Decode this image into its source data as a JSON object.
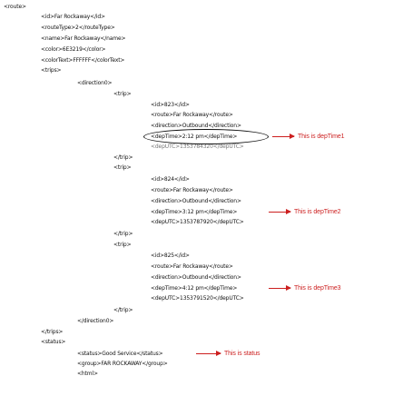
{
  "lines": [
    "<route>",
    "<id>Far Rockaway</id>",
    "<routeType>2</routeType>",
    "<name>Far Rockaway</name>",
    "<color>6E3219</color>",
    "<colorText>FFFFFF</colorText>",
    "<trips>",
    "<direction0>",
    "<trip>",
    "<id>823</id>",
    "<route>Far Rockaway</route>",
    "<direction>Outbound</direction>",
    "<depTime>2:12 pm</depTime>",
    "<depUTC>1353784320</depUTC>",
    "</trip>",
    "<trip>",
    "<id>824</id>",
    "<route>Far Rockaway</route>",
    "<direction>Outbound</direction>",
    "<depTime>3:12 pm</depTime>",
    "<depUTC>1353787920</depUTC>",
    "</trip>",
    "<trip>",
    "<id>825</id>",
    "<route>Far Rockaway</route>",
    "<direction>Outbound</direction>",
    "<depTime>4:12 pm</depTime>",
    "<depUTC>1353791520</depUTC>",
    "</trip>",
    "</direction0>",
    "</trips>",
    "<status>",
    "<status>Good Service</status>",
    "<group>FAR ROCKAWAY</group>",
    "<html>"
  ],
  "annotations": {
    "depTime1": "This is depTime1",
    "depTime2": "This is depTime2",
    "depTime3": "This is depTime3",
    "status": "This is status"
  },
  "colors": {
    "annotation": "#cc1f1f",
    "text": "#111111",
    "background": "#ffffff"
  }
}
